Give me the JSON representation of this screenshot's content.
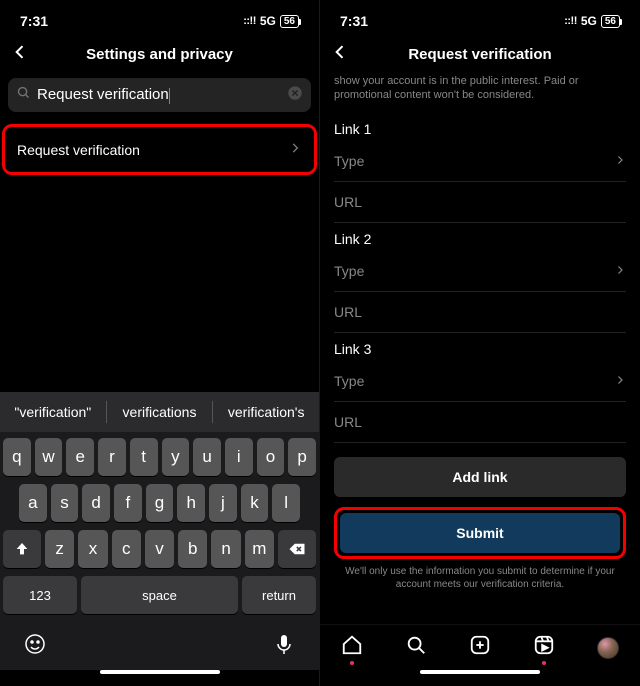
{
  "status": {
    "time": "7:31",
    "signal": "::!!",
    "network": "5G",
    "battery": "56"
  },
  "left": {
    "title": "Settings and privacy",
    "search_value": "Request verification",
    "result": "Request verification",
    "suggestions": [
      "\"verification\"",
      "verifications",
      "verification's"
    ],
    "keys": {
      "r1": [
        "q",
        "w",
        "e",
        "r",
        "t",
        "y",
        "u",
        "i",
        "o",
        "p"
      ],
      "r2": [
        "a",
        "s",
        "d",
        "f",
        "g",
        "h",
        "j",
        "k",
        "l"
      ],
      "r3": [
        "z",
        "x",
        "c",
        "v",
        "b",
        "n",
        "m"
      ],
      "k123": "123",
      "space": "space",
      "return": "return"
    }
  },
  "right": {
    "title": "Request verification",
    "desc": "show your account is in the public interest. Paid or promotional content won't be considered.",
    "link1": "Link 1",
    "link2": "Link 2",
    "link3": "Link 3",
    "type": "Type",
    "url": "URL",
    "addlink": "Add link",
    "submit": "Submit",
    "disclaimer": "We'll only use the information you submit to determine if your account meets our verification criteria."
  }
}
